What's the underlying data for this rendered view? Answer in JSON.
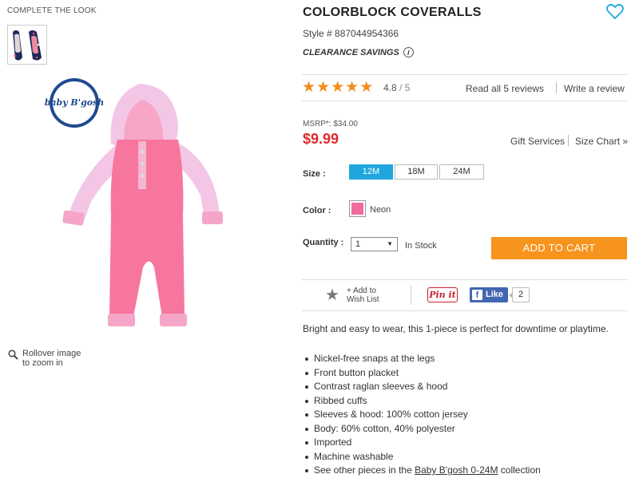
{
  "complete_the_look": "COMPLETE THE LOOK",
  "brand_logo_text": "baby B'gosh",
  "zoom_hint": [
    "Rollover image",
    "to zoom in"
  ],
  "product": {
    "title": "COLORBLOCK COVERALLS",
    "style_label": "Style # 887044954366",
    "clearance_label": "CLEARANCE SAVINGS",
    "info_glyph": "i"
  },
  "rating": {
    "stars": 5,
    "score": "4.8",
    "out_of": "/ 5",
    "read_reviews": "Read all 5 reviews",
    "write_review": "Write a review"
  },
  "pricing": {
    "msrp": "MSRP*: $34.00",
    "price": "$9.99",
    "gift_services": "Gift Services",
    "size_chart": "Size Chart »"
  },
  "size": {
    "label": "Size :",
    "options": [
      "12M",
      "18M",
      "24M"
    ],
    "selected": "12M"
  },
  "color": {
    "label": "Color :",
    "name": "Neon",
    "swatch_hex": "#f26a9e"
  },
  "quantity": {
    "label": "Quantity :",
    "value": "1",
    "stock": "In Stock"
  },
  "add_to_cart": "ADD TO CART",
  "social": {
    "wishlist": [
      "+ Add to",
      "Wish List"
    ],
    "pinit": "Pin it",
    "fb_like": "Like",
    "fb_count": "2"
  },
  "description": "Bright and easy to wear, this 1-piece is perfect for downtime or playtime.",
  "features": [
    "Nickel-free snaps at the legs",
    "Front button placket",
    "Contrast raglan sleeves & hood",
    "Ribbed cuffs",
    "Sleeves & hood: 100% cotton jersey",
    "Body: 60% cotton, 40% polyester",
    "Imported",
    "Machine washable"
  ],
  "collection_line": {
    "prefix": "See other pieces in the ",
    "link": "Baby B'gosh 0-24M",
    "suffix": " collection"
  },
  "colors": {
    "accent_blue": "#1fa6de",
    "cart_orange": "#f7941d",
    "price_red": "#e02a2a",
    "star_orange": "#f28c1e"
  }
}
